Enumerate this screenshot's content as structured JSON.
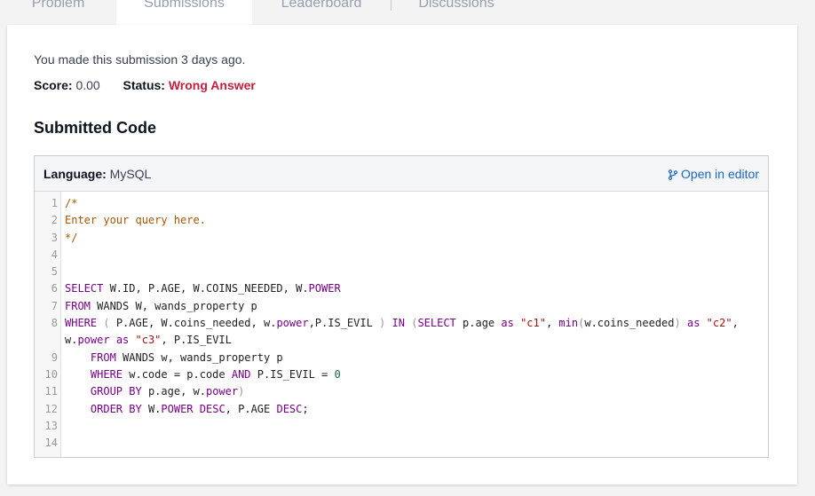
{
  "tabs": [
    "Problem",
    "Submissions",
    "Leaderboard",
    "Discussions"
  ],
  "submission": {
    "when": "You made this submission 3 days ago.",
    "score_label": "Score:",
    "score_value": "0.00",
    "status_label": "Status:",
    "status_value": "Wrong Answer",
    "status_color": "#c41e3a"
  },
  "heading": "Submitted Code",
  "code_panel": {
    "language_label": "Language:",
    "language_value": "MySQL",
    "open_editor": "Open in editor",
    "open_editor_icon": "branch-icon",
    "line_numbers": [
      "1",
      "2",
      "3",
      "4",
      "5",
      "6",
      "7",
      "8",
      "",
      "9",
      "10",
      "11",
      "12",
      "13",
      "14"
    ],
    "lines": [
      "/*",
      "Enter your query here.",
      "*/",
      "",
      "",
      "SELECT W.ID, P.AGE, W.COINS_NEEDED, W.POWER",
      "FROM WANDS W, wands_property p",
      "WHERE ( P.AGE, W.coins_needed, w.power,P.IS_EVIL ) IN (SELECT p.age as \"c1\", min(w.coins_needed) as \"c2\",",
      "w.power as \"c3\", P.IS_EVIL",
      "    FROM WANDS w, wands_property p",
      "    WHERE w.code = p.code AND P.IS_EVIL = 0",
      "    GROUP BY p.age, w.power)",
      "    ORDER BY W.POWER DESC, P.AGE DESC;",
      "",
      ""
    ]
  }
}
